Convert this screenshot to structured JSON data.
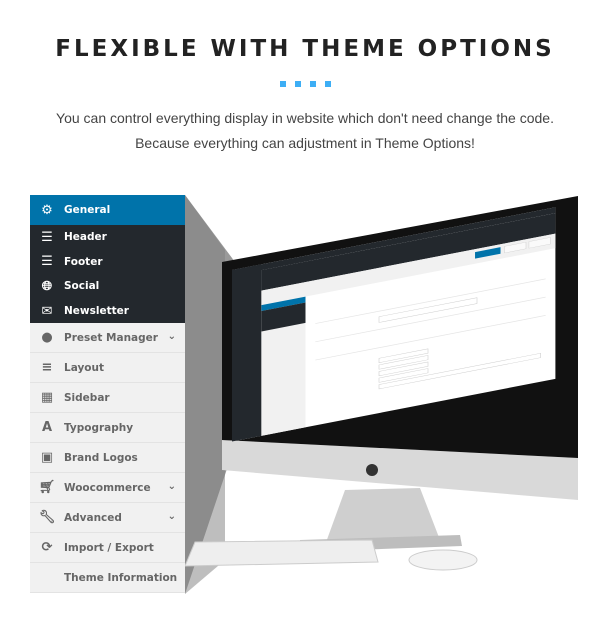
{
  "header": {
    "title": "FLEXIBLE WITH THEME OPTIONS",
    "description": "You can control everything display in website which don't need change the code. Because everything can adjustment in Theme Options!"
  },
  "colors": {
    "accent": "#3daef5",
    "active": "#0073aa",
    "dark": "#23282d",
    "light": "#f1f1f1"
  },
  "sidebar": {
    "items": [
      {
        "label": "General",
        "icon": "gear-icon",
        "state": "active"
      },
      {
        "label": "Header",
        "icon": "header-icon",
        "state": "dark"
      },
      {
        "label": "Footer",
        "icon": "footer-icon",
        "state": "dark"
      },
      {
        "label": "Social",
        "icon": "globe-icon",
        "state": "dark"
      },
      {
        "label": "Newsletter",
        "icon": "envelope-icon",
        "state": "dark"
      },
      {
        "label": "Preset Manager",
        "icon": "drop-icon",
        "chevron": true
      },
      {
        "label": "Layout",
        "icon": "layout-icon"
      },
      {
        "label": "Sidebar",
        "icon": "grid-icon"
      },
      {
        "label": "Typography",
        "icon": "font-icon"
      },
      {
        "label": "Brand Logos",
        "icon": "image-icon"
      },
      {
        "label": "Woocommerce",
        "icon": "cart-icon",
        "chevron": true
      },
      {
        "label": "Advanced",
        "icon": "wrench-icon",
        "chevron": true
      },
      {
        "label": "Import / Export",
        "icon": "refresh-icon"
      },
      {
        "label": "Theme Information",
        "icon": ""
      }
    ]
  }
}
